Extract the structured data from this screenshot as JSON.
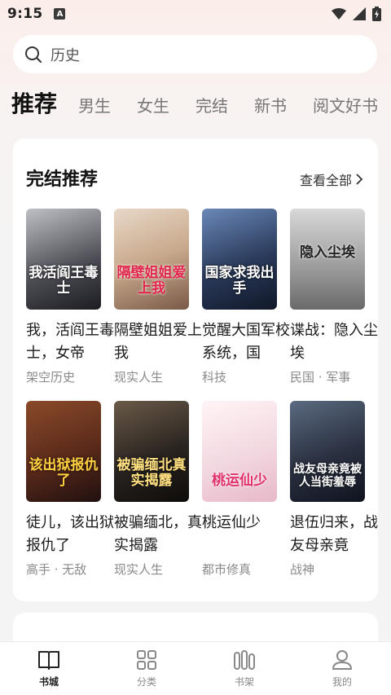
{
  "status_bar": {
    "time": "9:15",
    "badge": "A"
  },
  "search": {
    "placeholder": "历史"
  },
  "tabs": [
    {
      "label": "推荐",
      "active": true
    },
    {
      "label": "男生"
    },
    {
      "label": "女生"
    },
    {
      "label": "完结"
    },
    {
      "label": "新书"
    },
    {
      "label": "阅文好书"
    }
  ],
  "section": {
    "title": "完结推荐",
    "see_all": "查看全部"
  },
  "books": [
    {
      "title": "我，活阎王毒士，女帝",
      "tag": "架空历史",
      "cover_text": "我活阎王毒士",
      "cover_color": "#4a4a52"
    },
    {
      "title": "隔壁姐姐爱上我",
      "tag": "现实人生",
      "cover_text": "隔壁姐姐爱上我",
      "cover_color": "#c8a98c"
    },
    {
      "title": "觉醒大国军校系统，国",
      "tag": "科技",
      "cover_text": "国家求我出手",
      "cover_color": "#2a3a5a"
    },
    {
      "title": "谍战：隐入尘埃",
      "tag": "民国 · 军事",
      "cover_text": "隐入尘埃",
      "cover_color": "#9a9a9a"
    },
    {
      "title": "徒儿，该出狱报仇了",
      "tag": "高手 · 无敌",
      "cover_text": "该出狱报仇了",
      "cover_color": "#5a2a1a"
    },
    {
      "title": "被骗缅北，真实揭露",
      "tag": "现实人生",
      "cover_text": "被骗缅北真实揭露",
      "cover_color": "#2a2420"
    },
    {
      "title": "桃运仙少",
      "tag": "都市修真",
      "cover_text": "桃运仙少",
      "cover_color": "#f2d8e0"
    },
    {
      "title": "退伍归来，战友母亲竟",
      "tag": "战神",
      "cover_text": "战友母亲竟被人当街羞辱",
      "cover_color": "#2a3040"
    }
  ],
  "bottom_nav": [
    {
      "label": "书城",
      "icon": "book-open-icon",
      "active": true
    },
    {
      "label": "分类",
      "icon": "grid-icon"
    },
    {
      "label": "书架",
      "icon": "shelf-icon"
    },
    {
      "label": "我的",
      "icon": "user-icon"
    }
  ]
}
